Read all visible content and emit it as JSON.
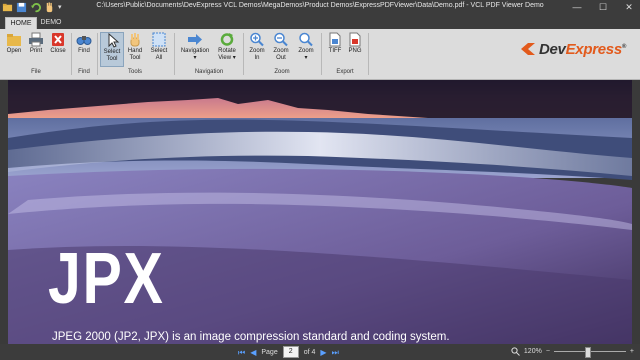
{
  "window": {
    "title": "C:\\Users\\Public\\Documents\\DevExpress VCL Demos\\MegaDemos\\Product Demos\\ExpressPDFViewer\\Data\\Demo.pdf - VCL PDF Viewer Demo",
    "min_glyph": "—",
    "max_glyph": "☐",
    "close_glyph": "✕"
  },
  "quick_access": {
    "items": [
      "open-icon",
      "save-icon",
      "undo-icon",
      "hand-icon",
      "dropdown-icon"
    ],
    "dropdown_glyph": "▾"
  },
  "tabs": [
    {
      "label": "HOME",
      "active": true
    },
    {
      "label": "DEMO",
      "active": false
    }
  ],
  "ribbon": {
    "buttons": {
      "open": "Open",
      "print": "Print",
      "close": "Close",
      "find": "Find",
      "select_tool_1": "Select",
      "select_tool_2": "Tool",
      "hand_tool_1": "Hand",
      "hand_tool_2": "Tool",
      "select_all_1": "Select",
      "select_all_2": "All",
      "navigation": "Navigation",
      "rotate_view_1": "Rotate",
      "rotate_view_2": "View ▾",
      "zoom_in_1": "Zoom",
      "zoom_in_2": "In",
      "zoom_out_1": "Zoom",
      "zoom_out_2": "Out",
      "zoom": "Zoom",
      "tiff": "TIFF",
      "png": "PNG",
      "dropdown_glyph": "▾"
    },
    "groups": {
      "file": "File",
      "find": "Find",
      "tools": "Tools",
      "navigation": "Navigation",
      "zoom": "Zoom",
      "export": "Export"
    },
    "logo_prefix": "Dev",
    "logo_suffix": "Express",
    "logo_reg": "®",
    "accent_color": "#e25a1c"
  },
  "document": {
    "heading": "JPX",
    "caption": "JPEG 2000 (JP2, JPX) is an image compression standard and coding system."
  },
  "status": {
    "first_glyph": "⏮",
    "prev_glyph": "◀",
    "page_label": "Page",
    "page_value": "2",
    "of_label": "of 4",
    "next_glyph": "▶",
    "last_glyph": "⏭",
    "zoom_value": "120%",
    "zoom_minus": "−",
    "zoom_plus": "+",
    "zoom_level": 0.45
  }
}
